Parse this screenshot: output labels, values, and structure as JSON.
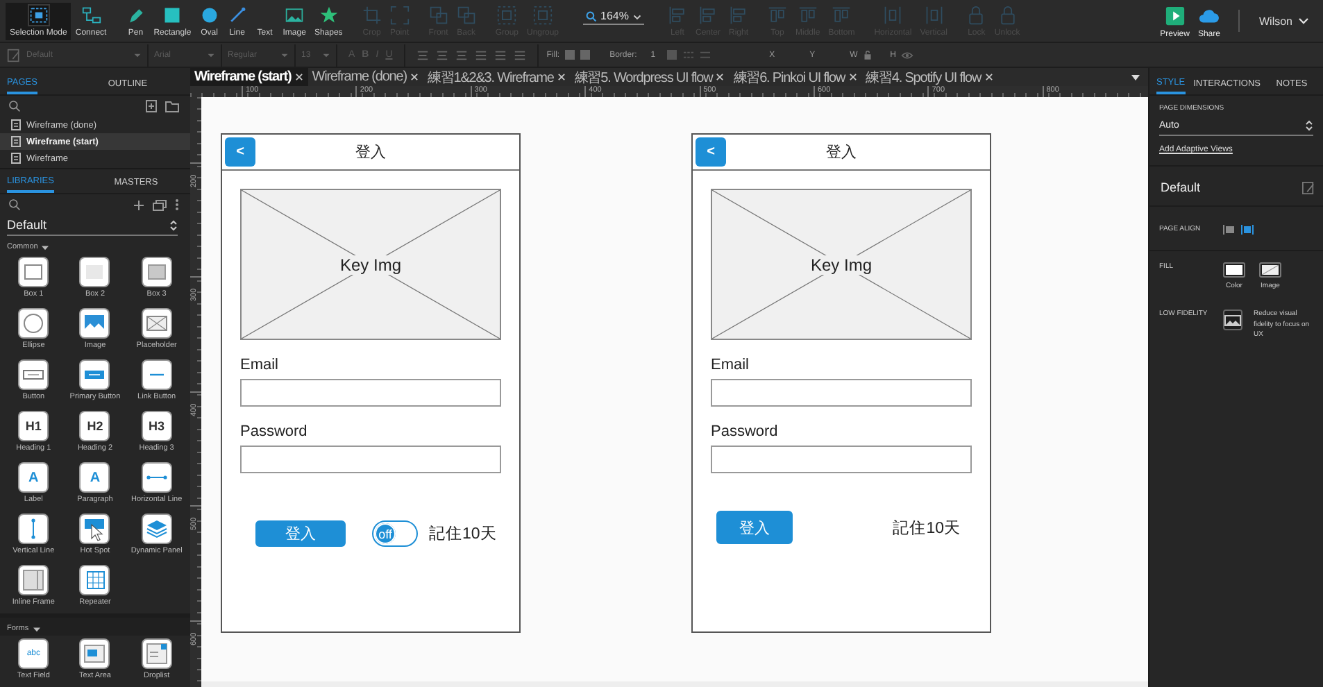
{
  "toolbar": {
    "left_groups": [
      {
        "tools": [
          {
            "label": "Selection Mode",
            "selected": true,
            "disabled": false
          },
          {
            "label": "Connect",
            "selected": false,
            "disabled": false
          }
        ]
      },
      {
        "tools": [
          {
            "label": "Pen",
            "selected": false,
            "disabled": false
          },
          {
            "label": "Rectangle",
            "selected": false,
            "disabled": false
          },
          {
            "label": "Oval",
            "selected": false,
            "disabled": false
          },
          {
            "label": "Line",
            "selected": false,
            "disabled": false
          },
          {
            "label": "Text",
            "selected": false,
            "disabled": false
          },
          {
            "label": "Image",
            "selected": false,
            "disabled": false
          },
          {
            "label": "Shapes",
            "selected": false,
            "disabled": false
          }
        ]
      },
      {
        "tools": [
          {
            "label": "Crop",
            "selected": false,
            "disabled": true
          },
          {
            "label": "Point",
            "selected": false,
            "disabled": true
          }
        ]
      },
      {
        "tools": [
          {
            "label": "Front",
            "selected": false,
            "disabled": true
          },
          {
            "label": "Back",
            "selected": false,
            "disabled": true
          }
        ]
      },
      {
        "tools": [
          {
            "label": "Group",
            "selected": false,
            "disabled": true
          },
          {
            "label": "Ungroup",
            "selected": false,
            "disabled": true
          }
        ]
      }
    ],
    "zoom": "164%",
    "right_groups": [
      {
        "tools": [
          {
            "label": "Left",
            "selected": false,
            "disabled": true
          },
          {
            "label": "Center",
            "selected": false,
            "disabled": true
          },
          {
            "label": "Right",
            "selected": false,
            "disabled": true
          }
        ]
      },
      {
        "tools": [
          {
            "label": "Top",
            "selected": false,
            "disabled": true
          },
          {
            "label": "Middle",
            "selected": false,
            "disabled": true
          },
          {
            "label": "Bottom",
            "selected": false,
            "disabled": true
          }
        ]
      },
      {
        "tools": [
          {
            "label": "Horizontal",
            "selected": false,
            "disabled": true
          },
          {
            "label": "Vertical",
            "selected": false,
            "disabled": true
          }
        ]
      },
      {
        "tools": [
          {
            "label": "Lock",
            "selected": false,
            "disabled": true
          },
          {
            "label": "Unlock",
            "selected": false,
            "disabled": true
          }
        ]
      }
    ],
    "actions": [
      "Preview",
      "Share"
    ],
    "user": "Wilson"
  },
  "format_bar": {
    "style": "Default",
    "font": "Arial",
    "weight": "Regular",
    "size": "13",
    "text_styles": [
      "A",
      "B",
      "I",
      "U"
    ],
    "fill_label": "Fill:",
    "border_label": "Border:",
    "border_value": "1",
    "coords": [
      "X",
      "Y",
      "W",
      "H"
    ]
  },
  "pages_panel": {
    "tabs": [
      {
        "label": "PAGES",
        "selected": true
      },
      {
        "label": "OUTLINE",
        "selected": false
      }
    ],
    "pages": [
      {
        "label": "Wireframe (done)",
        "selected": false
      },
      {
        "label": "Wireframe (start)",
        "selected": true
      },
      {
        "label": "Wireframe",
        "selected": false
      }
    ]
  },
  "libraries_panel": {
    "tabs": [
      {
        "label": "LIBRARIES",
        "selected": true
      },
      {
        "label": "MASTERS",
        "selected": false
      }
    ],
    "library": "Default",
    "sections": [
      {
        "title": "Common",
        "expanded": true,
        "widgets": [
          {
            "label": "Box 1",
            "kind": "box"
          },
          {
            "label": "Box 2",
            "kind": "shadedbox"
          },
          {
            "label": "Box 3",
            "kind": "greybox"
          },
          {
            "label": "Ellipse",
            "kind": "ellipse"
          },
          {
            "label": "Image",
            "kind": "image"
          },
          {
            "label": "Placeholder",
            "kind": "placeholder"
          },
          {
            "label": "Button",
            "kind": "button"
          },
          {
            "label": "Primary Button",
            "kind": "primarybutton"
          },
          {
            "label": "Link Button",
            "kind": "linkbutton"
          },
          {
            "label": "Heading 1",
            "kind": "heading",
            "glyph": "H1"
          },
          {
            "label": "Heading 2",
            "kind": "heading",
            "glyph": "H2"
          },
          {
            "label": "Heading 3",
            "kind": "heading",
            "glyph": "H3"
          },
          {
            "label": "Label",
            "kind": "label",
            "glyph": "A"
          },
          {
            "label": "Paragraph",
            "kind": "paragraph",
            "glyph": "A"
          },
          {
            "label": "Horizontal Line",
            "kind": "hline"
          },
          {
            "label": "Vertical Line",
            "kind": "vline"
          },
          {
            "label": "Hot Spot",
            "kind": "hotspot"
          },
          {
            "label": "Dynamic Panel",
            "kind": "panel"
          },
          {
            "label": "Inline Frame",
            "kind": "iframe"
          },
          {
            "label": "Repeater",
            "kind": "repeater"
          }
        ]
      },
      {
        "title": "Forms",
        "expanded": true,
        "widgets": [
          {
            "label": "Text Field",
            "kind": "textfield",
            "glyph": "abc"
          },
          {
            "label": "Text Area",
            "kind": "textarea"
          },
          {
            "label": "Droplist",
            "kind": "droplist"
          }
        ]
      }
    ]
  },
  "doc_tabs": [
    {
      "label": "Wireframe (start)",
      "selected": true
    },
    {
      "label": "Wireframe (done)",
      "selected": false
    },
    {
      "label": "練習1&2&3. Wireframe",
      "selected": false
    },
    {
      "label": "練習5. Wordpress UI flow",
      "selected": false
    },
    {
      "label": "練習6. Pinkoi UI flow",
      "selected": false
    },
    {
      "label": "練習4. Spotify UI flow",
      "selected": false
    }
  ],
  "rulers": {
    "horizontal": [
      "100",
      "200",
      "300",
      "400",
      "500",
      "600",
      "700",
      "800"
    ],
    "vertical": [
      "200",
      "300",
      "400",
      "500",
      "600"
    ]
  },
  "canvas": {
    "screens": [
      {
        "title": "登入",
        "back": "<",
        "image_label": "Key Img",
        "fields": [
          {
            "label": "Email"
          },
          {
            "label": "Password"
          }
        ],
        "login_button": "登入",
        "toggle": {
          "text": "off",
          "on": false
        },
        "remember": "記住10天"
      },
      {
        "title": "登入",
        "back": "<",
        "image_label": "Key Img",
        "fields": [
          {
            "label": "Email"
          },
          {
            "label": "Password"
          }
        ],
        "login_button": "登入",
        "remember": "記住10天"
      }
    ]
  },
  "style_panel": {
    "tabs": [
      {
        "label": "STYLE",
        "selected": true
      },
      {
        "label": "INTERACTIONS",
        "selected": false
      },
      {
        "label": "NOTES",
        "selected": false
      }
    ],
    "dimensions_label": "PAGE DIMENSIONS",
    "dimension": "Auto",
    "adaptive_link": "Add Adaptive Views",
    "style_name": "Default",
    "page_align": {
      "label": "PAGE ALIGN",
      "options": [
        {
          "selected": false
        },
        {
          "selected": true
        }
      ]
    },
    "fill": {
      "label": "FILL",
      "options": [
        {
          "label": "Color"
        },
        {
          "label": "Image"
        }
      ]
    },
    "low_fidelity": {
      "label": "LOW FIDELITY",
      "description": "Reduce visual fidelity to focus on UX"
    }
  }
}
